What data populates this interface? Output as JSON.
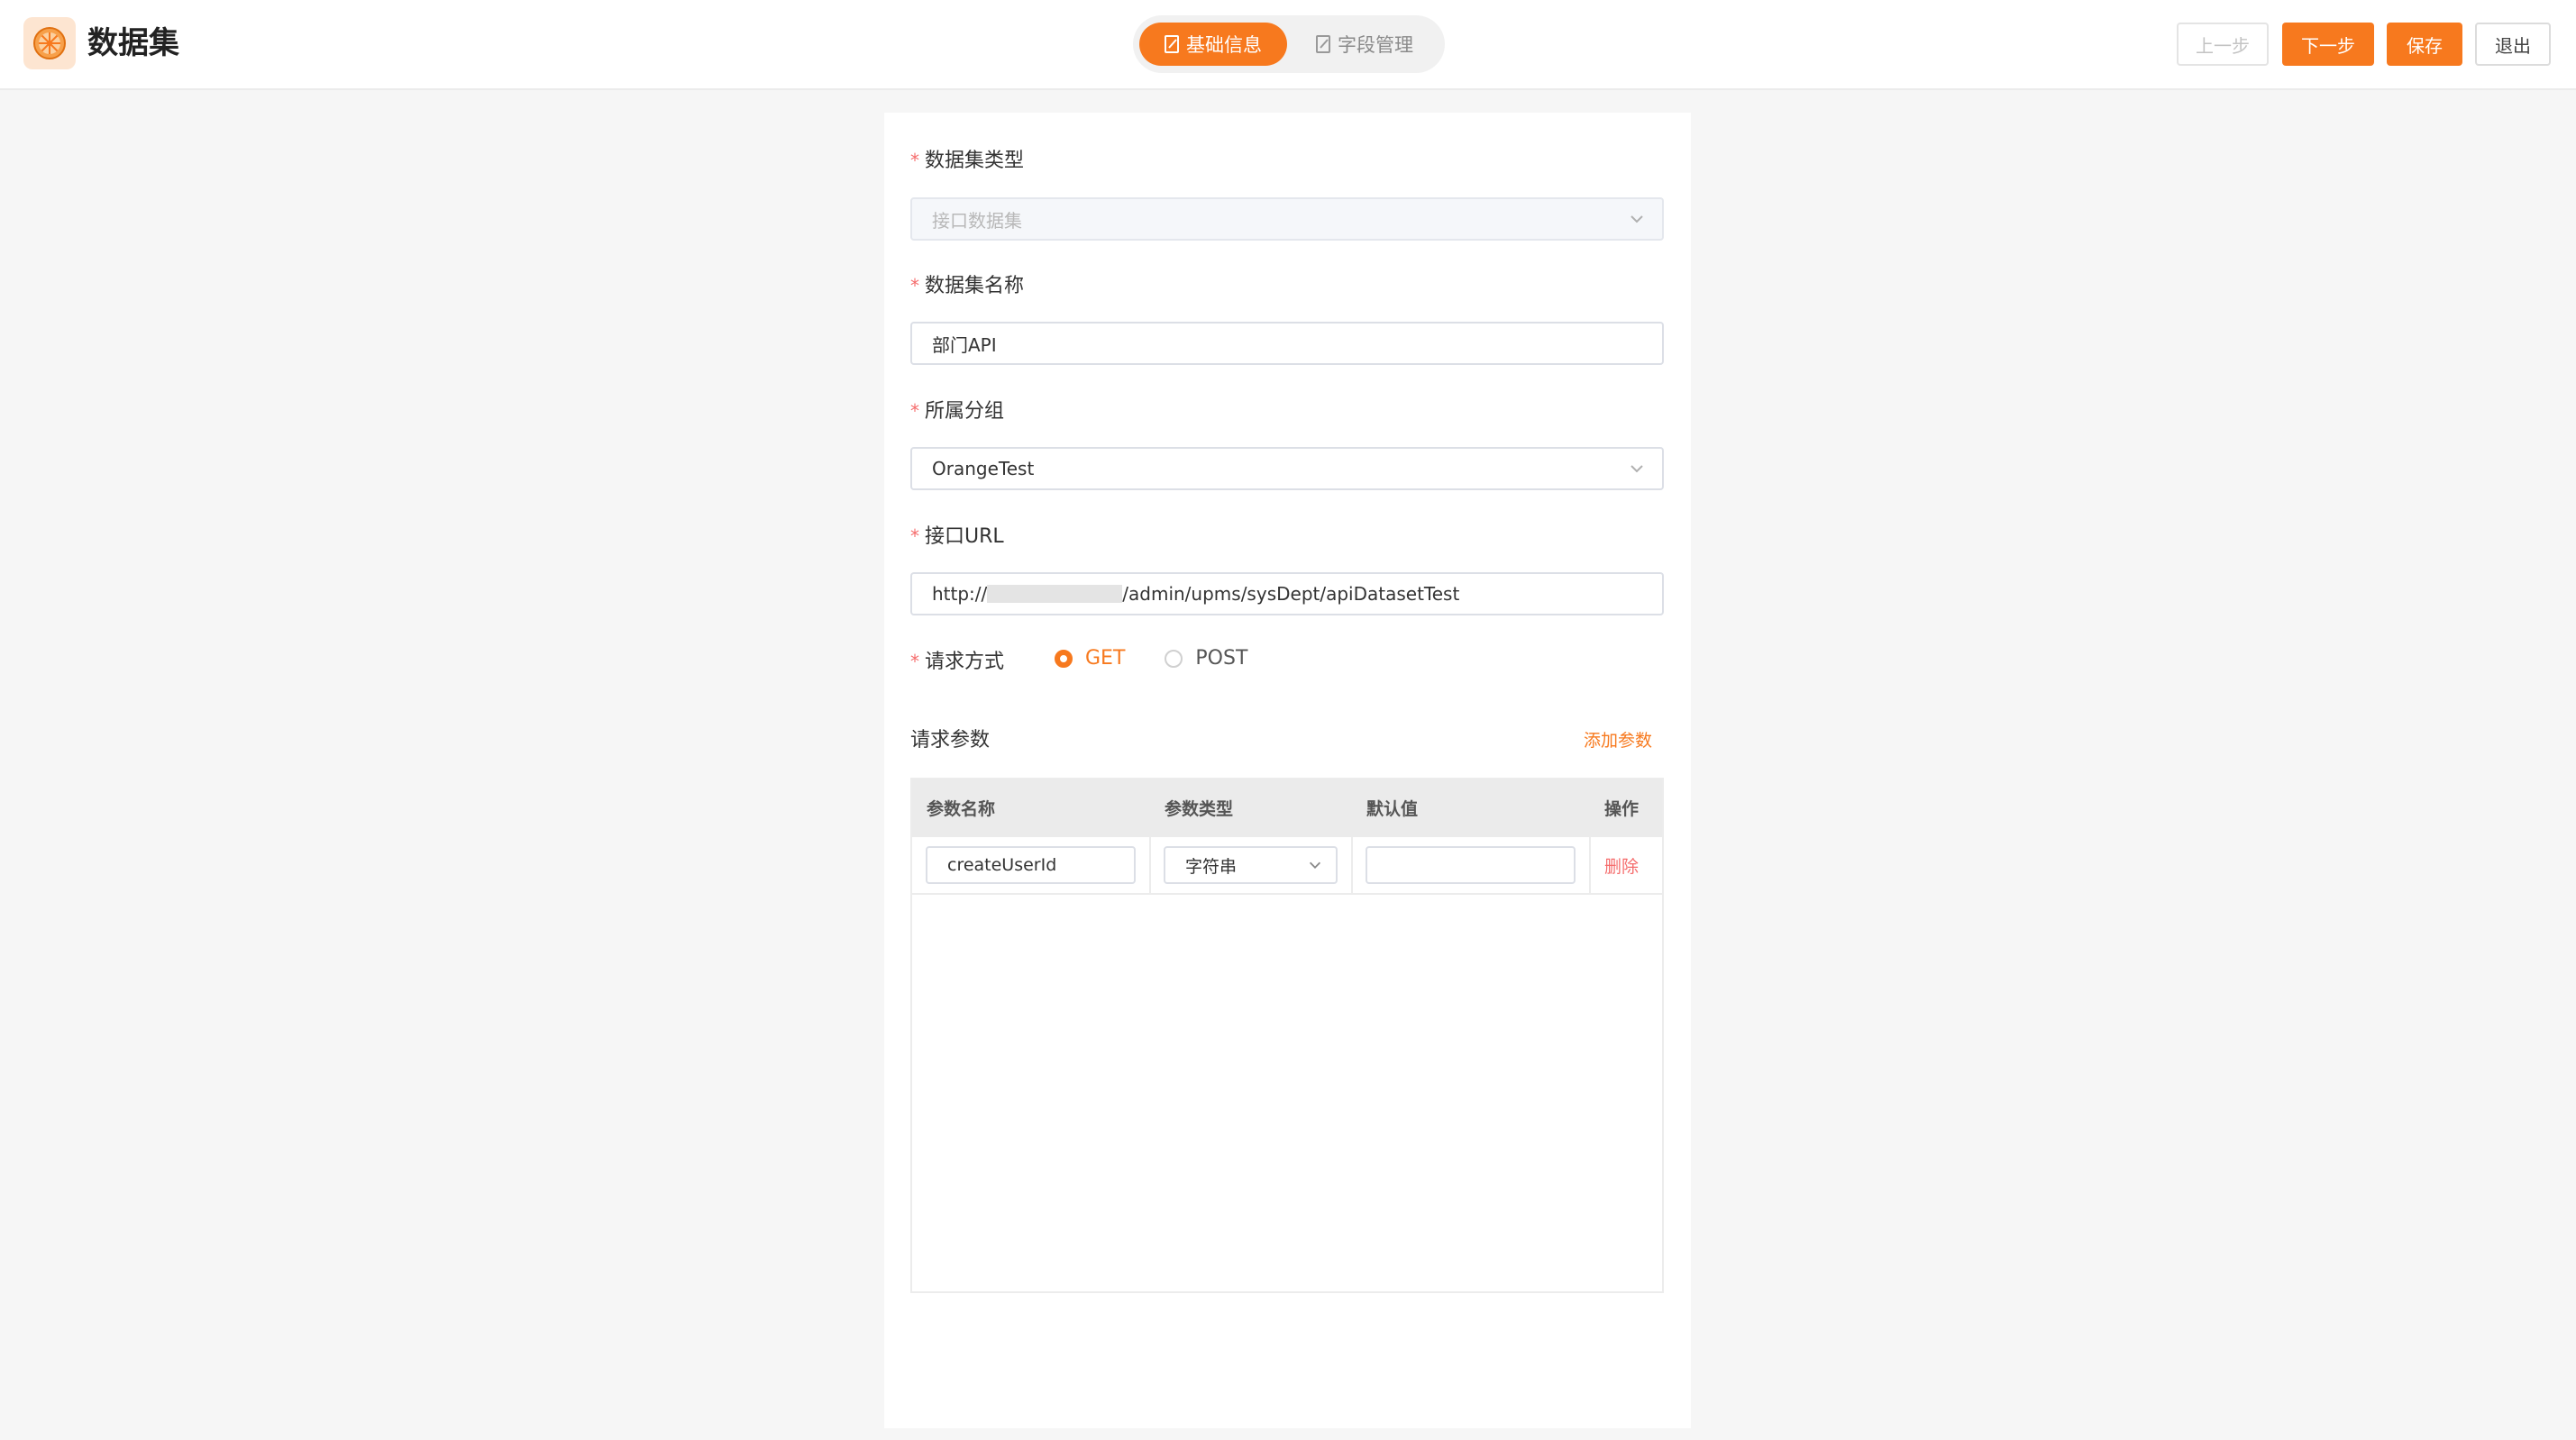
{
  "header": {
    "app_title": "数据集",
    "steps": [
      {
        "label": "基础信息",
        "active": true
      },
      {
        "label": "字段管理",
        "active": false
      }
    ],
    "buttons": {
      "prev": "上一步",
      "next": "下一步",
      "save": "保存",
      "exit": "退出"
    }
  },
  "form": {
    "dataset_type": {
      "label": "数据集类型",
      "value": "接口数据集",
      "disabled": true
    },
    "dataset_name": {
      "label": "数据集名称",
      "value": "部门API"
    },
    "group": {
      "label": "所属分组",
      "value": "OrangeTest"
    },
    "api_url": {
      "label": "接口URL",
      "value_prefix": "http://",
      "value_suffix": "/admin/upms/sysDept/apiDatasetTest"
    },
    "method": {
      "label": "请求方式",
      "options": [
        "GET",
        "POST"
      ],
      "selected": "GET"
    }
  },
  "params": {
    "title": "请求参数",
    "add_label": "添加参数",
    "columns": [
      "参数名称",
      "参数类型",
      "默认值",
      "操作"
    ],
    "rows": [
      {
        "name": "createUserId",
        "type": "字符串",
        "default": "",
        "action": "删除"
      }
    ]
  },
  "colors": {
    "accent": "#f7791e",
    "danger": "#f56c6c",
    "bg": "#f6f6f6"
  }
}
